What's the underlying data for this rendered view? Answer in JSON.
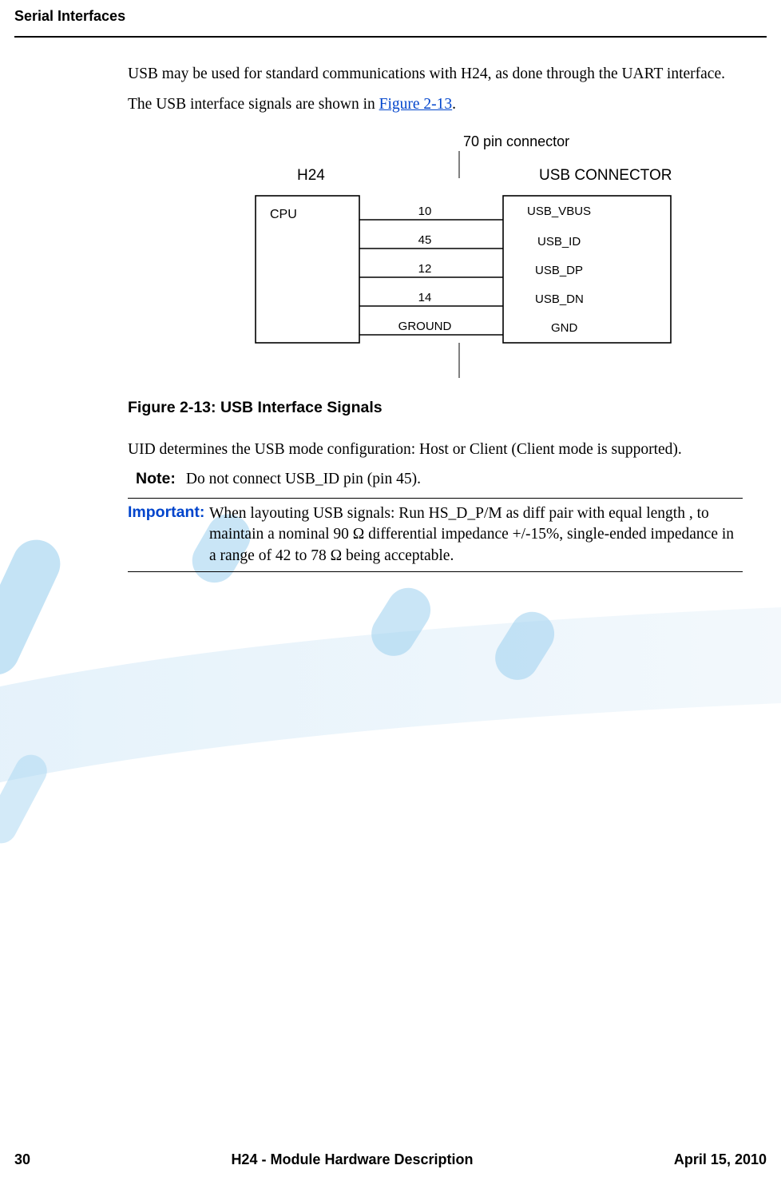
{
  "header": {
    "section": "Serial Interfaces"
  },
  "body": {
    "p1": "USB may be used for standard communications with H24, as done through the UART interface.",
    "p2_prefix": "The USB interface signals are shown in ",
    "p2_link": "Figure 2-13",
    "p2_suffix": "."
  },
  "diagram": {
    "top_label": "70 pin connector",
    "left_title": "H24",
    "left_box": "CPU",
    "right_title": "USB CONNECTOR",
    "lines": [
      {
        "pin": "10",
        "signal": "USB_VBUS"
      },
      {
        "pin": "45",
        "signal": "USB_ID"
      },
      {
        "pin": "12",
        "signal": "USB_DP"
      },
      {
        "pin": "14",
        "signal": "USB_DN"
      },
      {
        "pin": "GROUND",
        "signal": "GND"
      }
    ]
  },
  "figure_caption": "Figure 2-13: USB Interface Signals",
  "p3": "UID determines the USB mode configuration: Host or Client (Client mode is supported).",
  "note": {
    "label": "Note:",
    "text": "Do not connect USB_ID pin (pin 45)."
  },
  "important": {
    "label": "Important:",
    "text": "When layouting USB signals: Run HS_D_P/M as diff pair with equal length , to maintain a nominal 90 Ω differential impedance +/-15%, single-ended impedance in a range of 42 to 78 Ω being acceptable."
  },
  "footer": {
    "page": "30",
    "title": "H24 - Module Hardware Description",
    "date": "April 15, 2010"
  }
}
